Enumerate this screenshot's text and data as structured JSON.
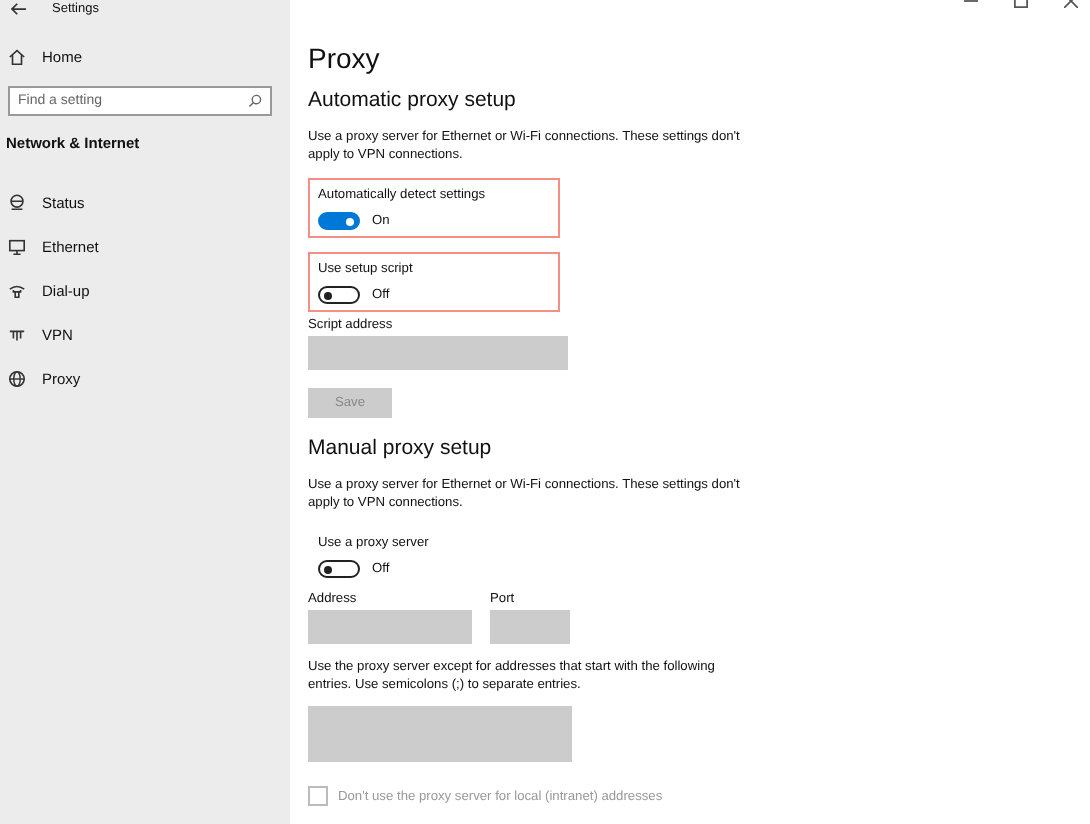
{
  "window": {
    "title": "Settings"
  },
  "sidebar": {
    "home": "Home",
    "search": {
      "placeholder": "Find a setting"
    },
    "section": "Network & Internet",
    "items": [
      {
        "label": "Status"
      },
      {
        "label": "Ethernet"
      },
      {
        "label": "Dial-up"
      },
      {
        "label": "VPN"
      },
      {
        "label": "Proxy"
      }
    ]
  },
  "page": {
    "title": "Proxy",
    "sections": [
      {
        "heading": "Automatic proxy setup",
        "items": [
          {
            "kind": "text",
            "text": "Use a proxy server for Ethernet or Wi-Fi connections. These settings don't apply to VPN connections."
          },
          {
            "kind": "toggle",
            "label": "Automatically detect settings",
            "on": true,
            "state_text": "On",
            "highlighted": true
          },
          {
            "kind": "toggle",
            "label": "Use setup script",
            "on": false,
            "state_text": "Off",
            "highlighted": true
          },
          {
            "kind": "fields",
            "fields": [
              {
                "label": "Script address",
                "disabled": true
              }
            ]
          },
          {
            "kind": "button",
            "label": "Save",
            "disabled": true
          }
        ]
      },
      {
        "heading": "Manual proxy setup",
        "items": [
          {
            "kind": "text",
            "text": "Use a proxy server for Ethernet or Wi-Fi connections. These settings don't apply to VPN connections."
          },
          {
            "kind": "toggle",
            "label": "Use a proxy server",
            "on": false,
            "state_text": "Off",
            "highlighted": false
          },
          {
            "kind": "fields",
            "fields": [
              {
                "label": "Address",
                "disabled": true
              },
              {
                "label": "Port",
                "disabled": true
              }
            ]
          },
          {
            "kind": "text",
            "text": "Use the proxy server except for addresses that start with the following entries. Use semicolons (;) to separate entries."
          },
          {
            "kind": "area",
            "disabled": true
          },
          {
            "kind": "checkbox",
            "label": "Don't use the proxy server for local (intranet) addresses",
            "checked": false,
            "disabled": true
          }
        ]
      }
    ]
  }
}
